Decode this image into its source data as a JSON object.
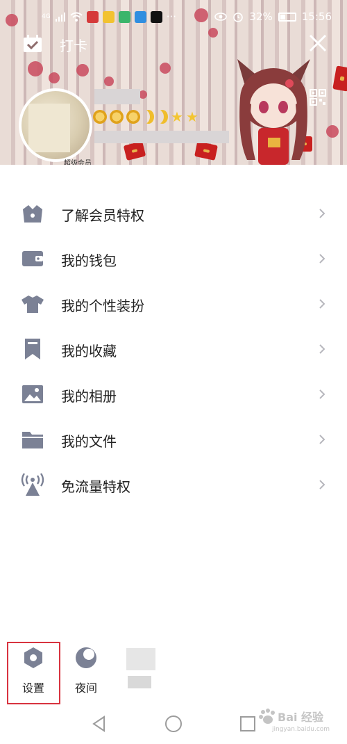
{
  "status_bar": {
    "network": "4G",
    "battery": "32%",
    "time": "15:56"
  },
  "header": {
    "checkin_label": "打卡",
    "vip_text": "超级会员"
  },
  "menu": {
    "items": [
      {
        "label": "了解会员特权",
        "icon": "vip-crown-icon"
      },
      {
        "label": "我的钱包",
        "icon": "wallet-icon"
      },
      {
        "label": "我的个性装扮",
        "icon": "shirt-icon"
      },
      {
        "label": "我的收藏",
        "icon": "bookmark-icon"
      },
      {
        "label": "我的相册",
        "icon": "photo-icon"
      },
      {
        "label": "我的文件",
        "icon": "folder-icon"
      },
      {
        "label": "免流量特权",
        "icon": "signal-tower-icon"
      }
    ]
  },
  "bottom_bar": {
    "settings_label": "设置",
    "night_label": "夜间"
  },
  "watermark": {
    "main": "Bai 经验",
    "sub": "jingyan.baidu.com"
  },
  "colors": {
    "icon_gray": "#7b8195",
    "highlight_red": "#d8333f",
    "chevron": "#b7b7bd"
  }
}
